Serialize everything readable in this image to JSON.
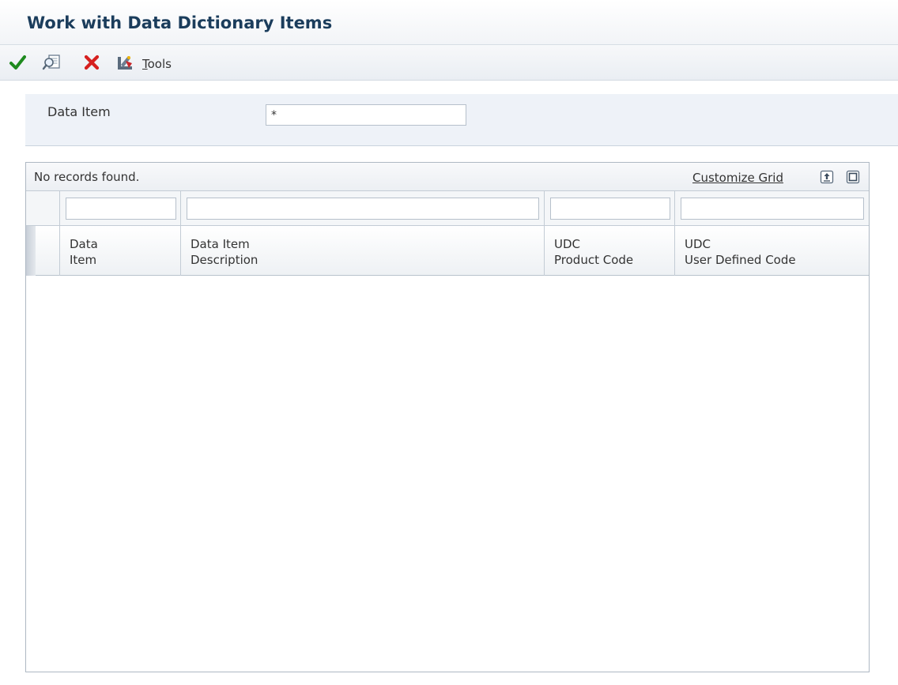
{
  "title": "Work with Data Dictionary Items",
  "toolbar": {
    "select_icon": "checkmark-icon",
    "find_icon": "find-icon",
    "close_icon": "close-icon",
    "tools_icon": "tools-icon",
    "tools_label": "Tools"
  },
  "search": {
    "label": "Data Item",
    "value": "*"
  },
  "grid": {
    "status": "No records found.",
    "customize_label": "Customize Grid",
    "export_icon": "export-icon",
    "maximize_icon": "maximize-icon",
    "columns": [
      {
        "line1": "Data",
        "line2": "Item"
      },
      {
        "line1": "Data Item",
        "line2": "Description"
      },
      {
        "line1": "UDC",
        "line2": "Product Code"
      },
      {
        "line1": "UDC",
        "line2": "User Defined Code"
      }
    ],
    "filters": [
      "",
      "",
      "",
      ""
    ],
    "rows": []
  },
  "colors": {
    "title": "#1b3d5c",
    "accept_green": "#1e8a1e",
    "close_red": "#d6201f"
  }
}
